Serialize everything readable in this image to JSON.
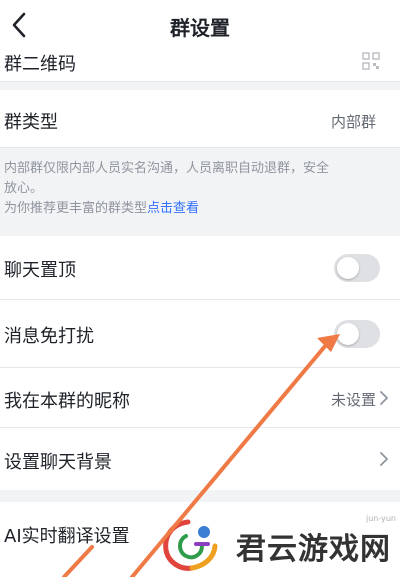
{
  "header": {
    "title": "群设置",
    "back_icon": "chevron-left-icon"
  },
  "rows": {
    "qr_code": {
      "label": "群二维码",
      "icon": "qr-code-icon"
    },
    "group_type": {
      "label": "群类型",
      "value": "内部群"
    },
    "notice": {
      "line1": "内部群仅限内部人员实名沟通，人员离职自动退群，安全",
      "line2": "放心。",
      "line3_prefix": "为你推荐更丰富的群类型",
      "line3_link": "点击查看"
    },
    "pin_chat": {
      "label": "聊天置顶",
      "toggle_on": false
    },
    "mute": {
      "label": "消息免打扰",
      "toggle_on": false
    },
    "nickname": {
      "label": "我在本群的昵称",
      "value": "未设置"
    },
    "background": {
      "label": "设置聊天背景"
    },
    "translate": {
      "label": "AI实时翻译设置"
    }
  },
  "watermark": {
    "text": "君云游戏网",
    "small": "jun-yun"
  },
  "colors": {
    "link": "#3370ff",
    "arrow": "#f07a45",
    "toggle_off": "#dee0e3"
  }
}
